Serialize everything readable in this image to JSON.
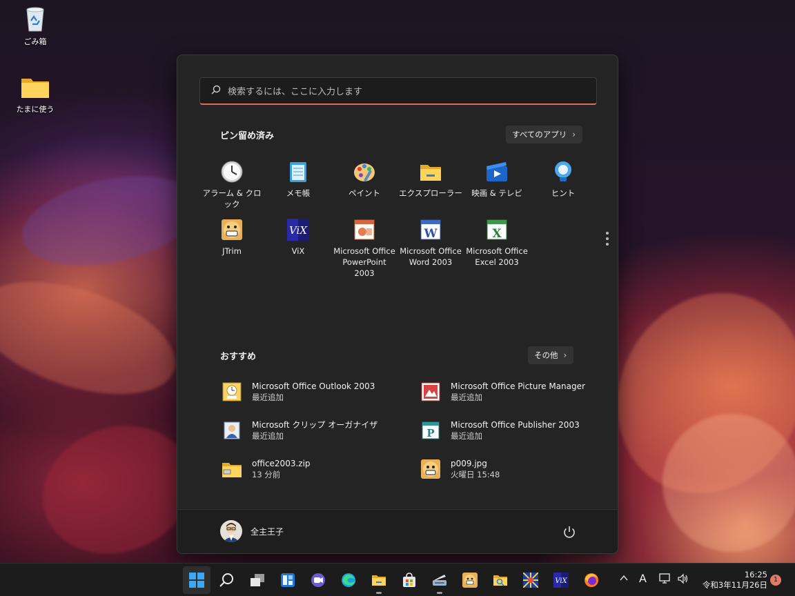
{
  "desktop": {
    "icons": [
      {
        "label": "ごみ箱",
        "icon": "recycle-bin-icon"
      },
      {
        "label": "たまに使う",
        "icon": "folder-icon"
      }
    ]
  },
  "start_menu": {
    "search_placeholder": "検索するには、ここに入力します",
    "pinned": {
      "title": "ピン留め済み",
      "all_apps_label": "すべてのアプリ",
      "apps": [
        {
          "label": "アラーム & クロック",
          "icon": "alarm-clock-icon"
        },
        {
          "label": "メモ帳",
          "icon": "notepad-icon"
        },
        {
          "label": "ペイント",
          "icon": "paint-icon"
        },
        {
          "label": "エクスプローラー",
          "icon": "explorer-folder-icon"
        },
        {
          "label": "映画 & テレビ",
          "icon": "movies-tv-icon"
        },
        {
          "label": "ヒント",
          "icon": "tips-bulb-icon"
        },
        {
          "label": "JTrim",
          "icon": "jtrim-icon"
        },
        {
          "label": "ViX",
          "icon": "vix-icon"
        },
        {
          "label": "Microsoft Office PowerPoint 2003",
          "icon": "powerpoint-icon"
        },
        {
          "label": "Microsoft Office Word 2003",
          "icon": "word-icon"
        },
        {
          "label": "Microsoft Office Excel 2003",
          "icon": "excel-icon"
        }
      ]
    },
    "recommended": {
      "title": "おすすめ",
      "more_label": "その他",
      "items": [
        {
          "name": "Microsoft Office Outlook 2003",
          "sub": "最近追加",
          "icon": "outlook-icon"
        },
        {
          "name": "Microsoft Office Picture Manager",
          "sub": "最近追加",
          "icon": "picture-manager-icon"
        },
        {
          "name": "Microsoft クリップ オーガナイザ",
          "sub": "最近追加",
          "icon": "clip-organizer-icon"
        },
        {
          "name": "Microsoft Office Publisher 2003",
          "sub": "最近追加",
          "icon": "publisher-icon"
        },
        {
          "name": "office2003.zip",
          "sub": "13 分前",
          "icon": "zip-folder-icon"
        },
        {
          "name": "p009.jpg",
          "sub": "火曜日 15:48",
          "icon": "image-file-icon"
        }
      ]
    },
    "user": {
      "name": "全主王子"
    }
  },
  "taskbar": {
    "buttons": [
      "start-icon",
      "search-icon",
      "task-view-icon",
      "widgets-icon",
      "chat-icon",
      "edge-icon",
      "file-explorer-icon",
      "store-icon",
      "scanner-icon",
      "jtrim-icon",
      "search-folder-icon",
      "puzzle-app-icon",
      "vix-icon",
      "firefox-icon"
    ],
    "ime_label": "A",
    "time": "16:25",
    "date": "令和3年11月26日",
    "notification_count": "1"
  }
}
